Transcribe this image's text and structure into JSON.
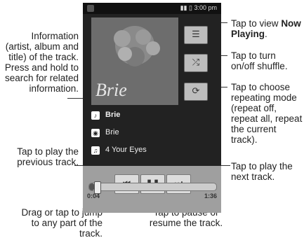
{
  "status": {
    "time": "3:00 pm"
  },
  "album_art": {
    "text": "Brie"
  },
  "track": {
    "artist": "Brie",
    "album": "Brie",
    "title": "4 Your Eyes"
  },
  "player": {
    "elapsed": "0:04",
    "duration": "1:36",
    "progress_fraction": 0.04,
    "icons": {
      "now_playing": "list-icon",
      "shuffle": "shuffle-icon",
      "repeat": "repeat-icon",
      "prev": "previous-track-icon",
      "pause": "pause-icon",
      "next": "next-track-icon"
    }
  },
  "callouts": {
    "info": "Information (artist, album and title) of the track. Press and hold to search for related information.",
    "prev": "Tap to play the previous track.",
    "drag": "Drag or tap to jump to any part of the track.",
    "pause": "Tap to pause or resume the track.",
    "now_playing_prefix": "Tap to view",
    "now_playing_bold": "Now Playing",
    "now_playing_suffix": ".",
    "shuffle": "Tap to turn on/off shuffle.",
    "repeat": "Tap to choose repeating mode (repeat off, repeat all, repeat the current track).",
    "next": "Tap to play the next track."
  }
}
